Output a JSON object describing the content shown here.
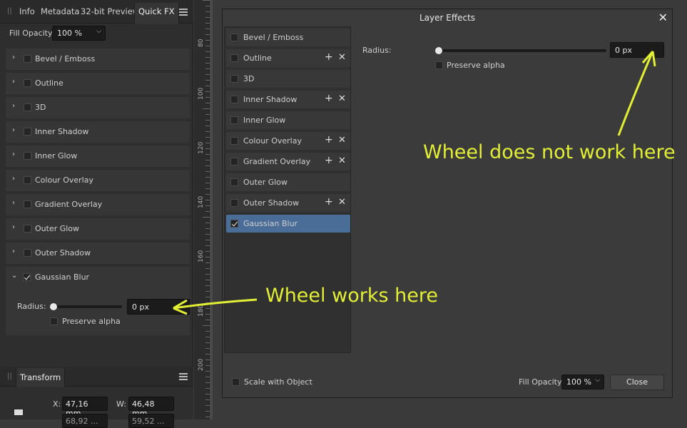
{
  "left_panel": {
    "tabs": [
      "Info",
      "Metadata",
      "32-bit Preview",
      "Quick FX"
    ],
    "active_tab": "Quick FX",
    "fill_opacity_label": "Fill Opacity:",
    "fill_opacity_value": "100 %",
    "effects": [
      {
        "label": "Bevel / Emboss",
        "checked": false
      },
      {
        "label": "Outline",
        "checked": false
      },
      {
        "label": "3D",
        "checked": false
      },
      {
        "label": "Inner Shadow",
        "checked": false
      },
      {
        "label": "Inner Glow",
        "checked": false
      },
      {
        "label": "Colour Overlay",
        "checked": false
      },
      {
        "label": "Gradient Overlay",
        "checked": false
      },
      {
        "label": "Outer Glow",
        "checked": false
      },
      {
        "label": "Outer Shadow",
        "checked": false
      },
      {
        "label": "Gaussian Blur",
        "checked": true
      }
    ],
    "gaussian": {
      "radius_label": "Radius:",
      "radius_value": "0 px",
      "preserve_alpha_label": "Preserve alpha"
    },
    "transform": {
      "tab": "Transform",
      "x_label": "X:",
      "x_value": "47,16 mm",
      "w_label": "W:",
      "w_value": "46,48 mm",
      "y_value_partial": "68,92 ...",
      "h_value_partial": "59,52 ..."
    }
  },
  "ruler": {
    "labels": [
      "80",
      "100",
      "120",
      "140",
      "160",
      "180",
      "200"
    ]
  },
  "dialog": {
    "title": "Layer Effects",
    "effects": [
      {
        "label": "Bevel / Emboss",
        "checked": false,
        "addable": false
      },
      {
        "label": "Outline",
        "checked": false,
        "addable": true
      },
      {
        "label": "3D",
        "checked": false,
        "addable": false
      },
      {
        "label": "Inner Shadow",
        "checked": false,
        "addable": true
      },
      {
        "label": "Inner Glow",
        "checked": false,
        "addable": false
      },
      {
        "label": "Colour Overlay",
        "checked": false,
        "addable": true
      },
      {
        "label": "Gradient Overlay",
        "checked": false,
        "addable": true
      },
      {
        "label": "Outer Glow",
        "checked": false,
        "addable": false
      },
      {
        "label": "Outer Shadow",
        "checked": false,
        "addable": true
      },
      {
        "label": "Gaussian Blur",
        "checked": true,
        "addable": false,
        "selected": true
      }
    ],
    "radius_label": "Radius:",
    "radius_value": "0 px",
    "preserve_alpha_label": "Preserve alpha",
    "scale_with_object_label": "Scale with Object",
    "fill_opacity_label": "Fill Opacity:",
    "fill_opacity_value": "100 %",
    "close_label": "Close"
  },
  "annotations": {
    "works_here": "Wheel works here",
    "not_work_here": "Wheel does not work here",
    "color": "#e2ef34"
  }
}
